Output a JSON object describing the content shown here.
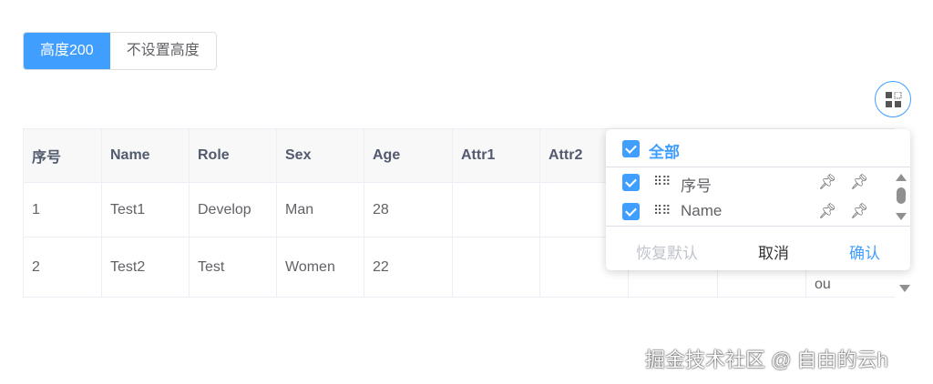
{
  "buttons": {
    "height200": "高度200",
    "no_height": "不设置高度"
  },
  "table": {
    "headers": [
      "序号",
      "Name",
      "Role",
      "Sex",
      "Age",
      "Attr1",
      "Attr2",
      "",
      "",
      ""
    ],
    "rows": [
      [
        "1",
        "Test1",
        "Develop",
        "Man",
        "28",
        "",
        "",
        "",
        "",
        ""
      ],
      [
        "2",
        "Test2",
        "Test",
        "Women",
        "22",
        "",
        "",
        "",
        "",
        "ou"
      ]
    ]
  },
  "popover": {
    "select_all": "全部",
    "items": [
      {
        "label": "序号"
      },
      {
        "label": "Name"
      }
    ],
    "reset": "恢复默认",
    "cancel": "取消",
    "confirm": "确认"
  },
  "watermark": "掘金技术社区 @ 自由的云h"
}
